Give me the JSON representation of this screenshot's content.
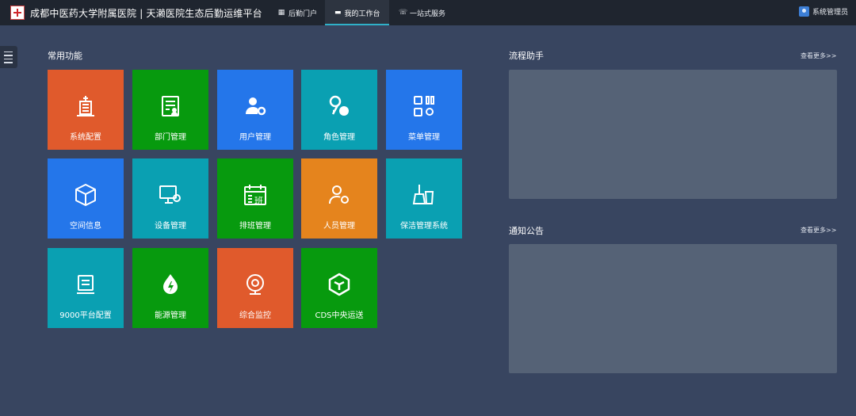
{
  "header": {
    "app_title": "成都中医药大学附属医院 | 天濑医院生态后勤运维平台",
    "nav": [
      {
        "label": "后勤门户",
        "icon": "grid-icon"
      },
      {
        "label": "我的工作台",
        "icon": "monitor-icon"
      },
      {
        "label": "一站式服务",
        "icon": "service-icon"
      }
    ],
    "active_nav": "我的工作台",
    "user_label": "系统管理员"
  },
  "main": {
    "common_title": "常用功能",
    "tiles": [
      {
        "label": "系统配置",
        "icon": "building-icon",
        "color": "#e05a2c"
      },
      {
        "label": "部门管理",
        "icon": "document-person-icon",
        "color": "#079a0e"
      },
      {
        "label": "用户管理",
        "icon": "user-gear-icon",
        "color": "#2476ea"
      },
      {
        "label": "角色管理",
        "icon": "key-user-icon",
        "color": "#0aa0b2"
      },
      {
        "label": "菜单管理",
        "icon": "menu-grid-icon",
        "color": "#2476ea"
      },
      {
        "label": "空间信息",
        "icon": "cube-icon",
        "color": "#2476ea"
      },
      {
        "label": "设备管理",
        "icon": "monitor-gear-icon",
        "color": "#0aa0b2"
      },
      {
        "label": "排班管理",
        "icon": "calendar-shift-icon",
        "color": "#079a0e"
      },
      {
        "label": "人员管理",
        "icon": "person-gear-icon",
        "color": "#e5841d"
      },
      {
        "label": "保洁管理系统",
        "icon": "broom-icon",
        "color": "#0aa0b2"
      },
      {
        "label": "9000平台配置",
        "icon": "terminal-icon",
        "color": "#0aa0b2"
      },
      {
        "label": "能源管理",
        "icon": "energy-drop-icon",
        "color": "#079a0e"
      },
      {
        "label": "综合监控",
        "icon": "camera-icon",
        "color": "#e05a2c"
      },
      {
        "label": "CDS中央运送",
        "icon": "box-icon",
        "color": "#079a0e"
      }
    ],
    "shift_glyph": "班"
  },
  "right": {
    "process_title": "流程助手",
    "process_more": "查看更多>>",
    "notice_title": "通知公告",
    "notice_more": "查看更多>>"
  }
}
